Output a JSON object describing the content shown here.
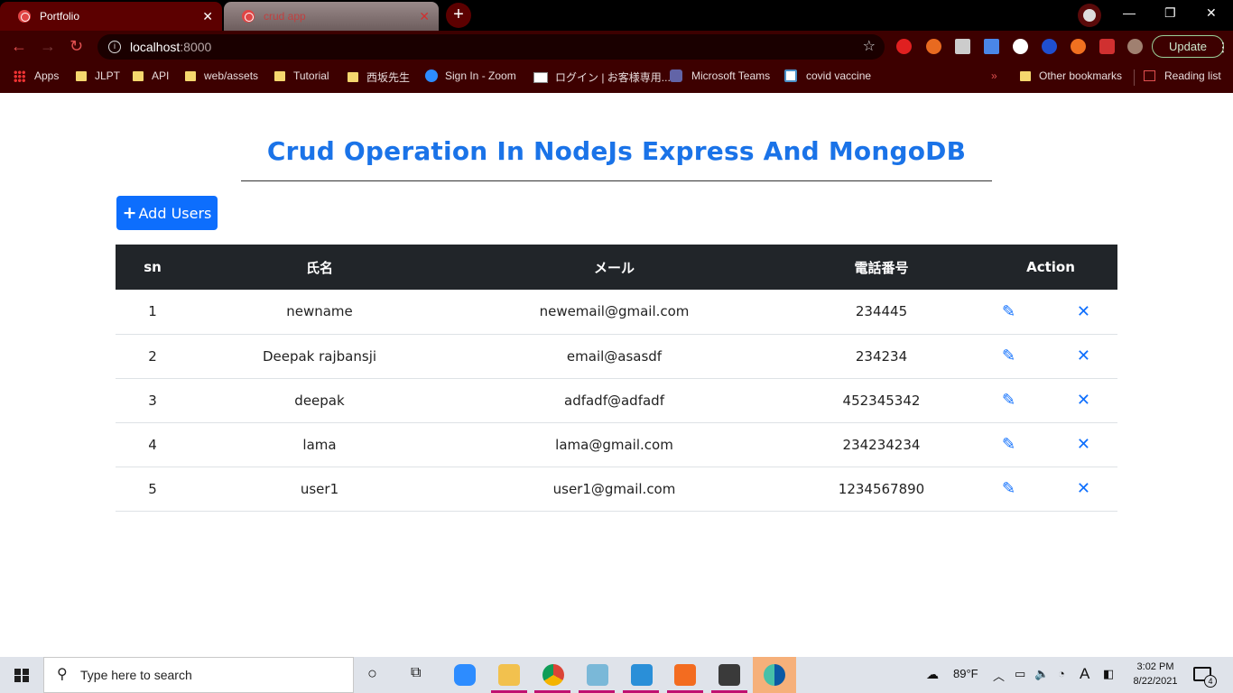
{
  "browser": {
    "tabs": [
      {
        "title": "Portfolio",
        "active": false
      },
      {
        "title": "crud app",
        "active": true
      }
    ],
    "address": {
      "host": "localhost",
      "port": ":8000"
    },
    "update_label": "Update",
    "bookmarks": [
      "Apps",
      "JLPT",
      "API",
      "web/assets",
      "Tutorial",
      "西坂先生",
      "Sign In - Zoom",
      "ログイン | お客様専用...",
      "Microsoft Teams",
      "covid vaccine"
    ],
    "overflow": "»",
    "other_bookmarks": "Other bookmarks",
    "reading_list": "Reading list"
  },
  "page": {
    "title": "Crud Operation In NodeJs Express And MongoDB",
    "add_button_label": "Add Users",
    "add_button_icon": "+",
    "columns": [
      "sn",
      "氏名",
      "メール",
      "電話番号",
      "Action"
    ],
    "rows": [
      {
        "sn": "1",
        "name": "newname",
        "email": "newemail@gmail.com",
        "phone": "234445"
      },
      {
        "sn": "2",
        "name": "Deepak rajbansji",
        "email": "email@asasdf",
        "phone": "234234"
      },
      {
        "sn": "3",
        "name": "deepak",
        "email": "adfadf@adfadf",
        "phone": "452345342"
      },
      {
        "sn": "4",
        "name": "lama",
        "email": "lama@gmail.com",
        "phone": "234234234"
      },
      {
        "sn": "5",
        "name": "user1",
        "email": "user1@gmail.com",
        "phone": "1234567890"
      }
    ],
    "edit_icon": "✎",
    "delete_icon": "✕",
    "accent_color": "#0d6efd"
  },
  "taskbar": {
    "search_placeholder": "Type here to search",
    "weather": "89°F",
    "language": "A",
    "time": "3:02 PM",
    "date": "8/22/2021",
    "notification_count": "4"
  }
}
